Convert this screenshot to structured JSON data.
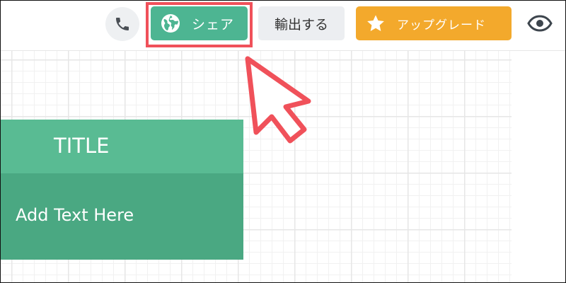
{
  "toolbar": {
    "share_label": "シェア",
    "export_label": "輸出する",
    "upgrade_label": "アップグレード"
  },
  "card": {
    "title": "TITLE",
    "body": "Add Text  Here"
  },
  "colors": {
    "share": "#4db592",
    "upgrade": "#f3a92c",
    "highlight": "#f0515a",
    "card_header": "#59bb93",
    "card_body": "#4aa882"
  },
  "icons": {
    "phone": "phone-icon",
    "globe": "globe-icon",
    "star": "star-icon",
    "eye": "eye-icon",
    "cursor": "cursor-arrow-icon"
  }
}
